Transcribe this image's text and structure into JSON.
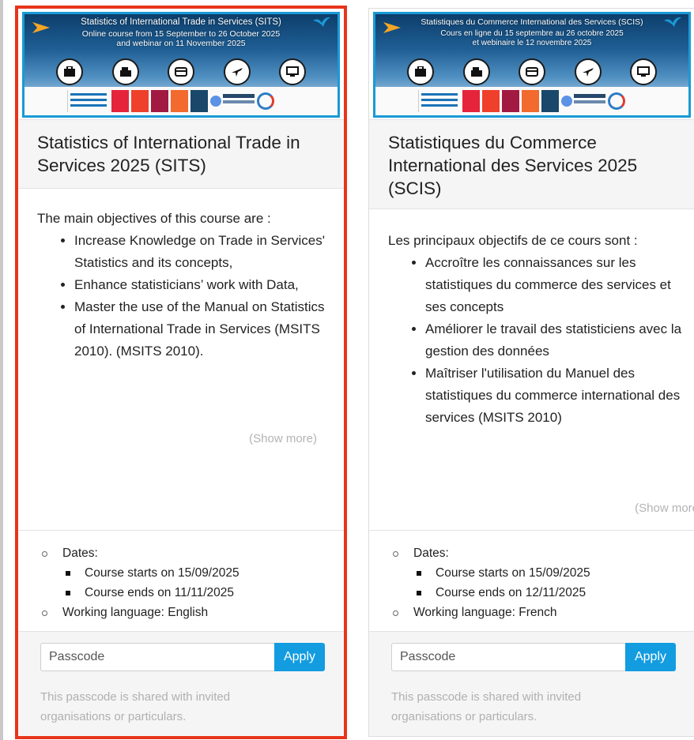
{
  "colors": {
    "accent": "#139ce0",
    "selected_outline": "#e8341c",
    "banner_border": "#1a9ad6",
    "muted_text": "#b0b0b0",
    "header_bg": "#f5f5f5"
  },
  "courses": [
    {
      "banner": {
        "title": "Statistics of International Trade in Services (SITS)",
        "line1": "Online course from 15 September to 26 October 2025",
        "line2": "and webinar on 11 November 2025",
        "icons": [
          "briefcase-icon",
          "cash-register-icon",
          "credit-card-icon",
          "airplane-icon",
          "monitor-icon"
        ],
        "logo_un": "UN trade & development"
      },
      "title": "Statistics of International Trade in Services 2025 (SITS)",
      "intro": "The main objectives of this course are :",
      "objectives": [
        "Increase Knowledge on Trade in Services' Statistics and its concepts,",
        "Enhance statisticians’ work with Data,",
        "Master the use of the Manual on Statistics of International Trade in Services (MSITS 2010). (MSITS 2010)."
      ],
      "show_more": "(Show more)",
      "dates_label": "Dates:",
      "start": "Course starts on 15/09/2025",
      "end": "Course ends on 11/11/2025",
      "language": "Working language: English",
      "passcode_placeholder": "Passcode",
      "apply": "Apply",
      "note": "This passcode is shared with invited organisations or particulars."
    },
    {
      "banner": {
        "title": "Statistiques du Commerce International des Services (SCIS)",
        "line1": "Cours en ligne du 15 septembre au 26 octobre 2025",
        "line2": "et webinaire le 12 novembre 2025",
        "icons": [
          "briefcase-icon",
          "cash-register-icon",
          "credit-card-icon",
          "airplane-icon",
          "monitor-icon"
        ],
        "logo_un": "ONU commerce et développement"
      },
      "title": "Statistiques du Commerce International des Services 2025 (SCIS)",
      "intro": "Les principaux objectifs de ce cours sont :",
      "objectives": [
        "Accroître les connaissances sur les statistiques du commerce des services et ses concepts",
        " Améliorer le travail des statisticiens avec la gestion des données",
        " Maîtriser l'utilisation du Manuel des statistiques du commerce international des services (MSITS 2010)"
      ],
      "show_more": "(Show more)",
      "dates_label": "Dates:",
      "start": "Course starts on 15/09/2025",
      "end": "Course ends on 12/11/2025",
      "language": "Working language: French",
      "passcode_placeholder": "Passcode",
      "apply": "Apply",
      "note": "This passcode is shared with invited organisations or particulars."
    }
  ]
}
